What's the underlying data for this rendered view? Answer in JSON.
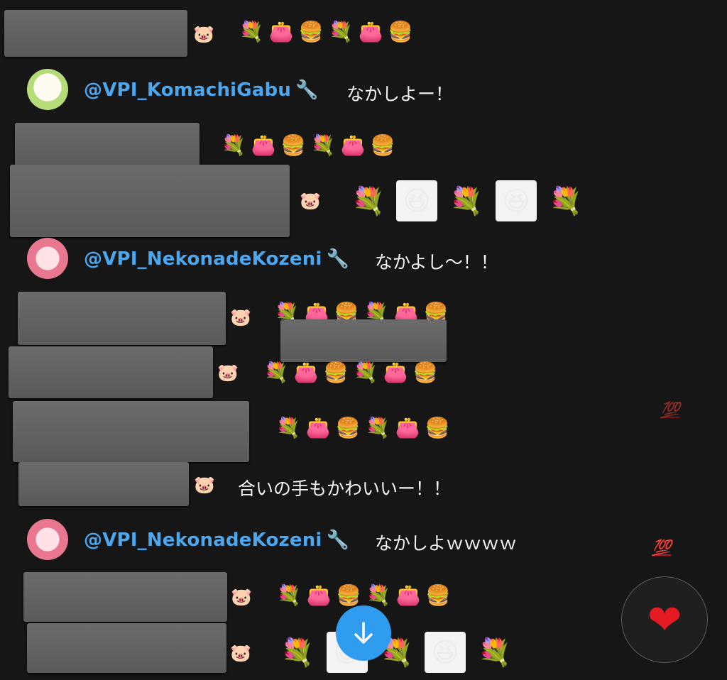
{
  "icons": {
    "pig": "🐷",
    "bouquet": "💐",
    "purse": "👛",
    "burger": "🍔",
    "flowers": "💐",
    "face": "😆",
    "hundred": "💯",
    "heart": "❤",
    "wrench": "🔧"
  },
  "messages": [
    {
      "user": "@VPI_KomachiGabu",
      "text": "なかしよー！"
    },
    {
      "user": "@VPI_NekonadeKozeni",
      "text": "なかよし〜！！"
    },
    {
      "user": "@VPI_NekonadeKozeni",
      "text": "なかしよｗｗｗｗ"
    }
  ],
  "anon_messages": [
    {
      "text": "合いの手もかわいいー！！"
    }
  ],
  "colors": {
    "background": "#161616",
    "username": "#4aa7f0",
    "scroll_button": "#2f9cf0",
    "heart": "#e51b23"
  }
}
